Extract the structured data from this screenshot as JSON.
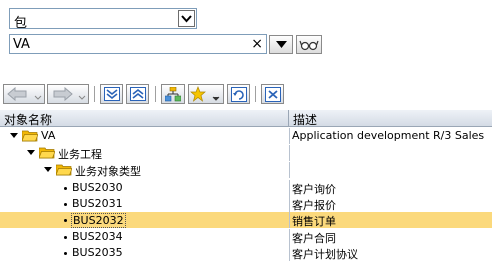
{
  "object_type": {
    "selected": "包"
  },
  "search": {
    "value": "VA",
    "clear_symbol": "×"
  },
  "table": {
    "columns": [
      "对象名称",
      "描述"
    ],
    "rows": [
      {
        "name": "VA",
        "desc": "Application development R/3 Sales",
        "kind": "folder",
        "expanded": true,
        "level": 0
      },
      {
        "name": "业务工程",
        "desc": "",
        "kind": "folder",
        "expanded": true,
        "level": 1
      },
      {
        "name": "业务对象类型",
        "desc": "",
        "kind": "folder",
        "expanded": true,
        "level": 2
      },
      {
        "name": "BUS2030",
        "desc": "客户询价",
        "kind": "leaf",
        "level": 3
      },
      {
        "name": "BUS2031",
        "desc": "客户报价",
        "kind": "leaf",
        "level": 3
      },
      {
        "name": "BUS2032",
        "desc": "销售订单",
        "kind": "leaf",
        "level": 3,
        "selected": true
      },
      {
        "name": "BUS2034",
        "desc": "客户合同",
        "kind": "leaf",
        "level": 3
      },
      {
        "name": "BUS2035",
        "desc": "客户计划协议",
        "kind": "leaf",
        "level": 3
      }
    ]
  },
  "colors": {
    "selection": "#fbd97c",
    "folder": "#f2b705",
    "header": "#d4dbe5"
  }
}
